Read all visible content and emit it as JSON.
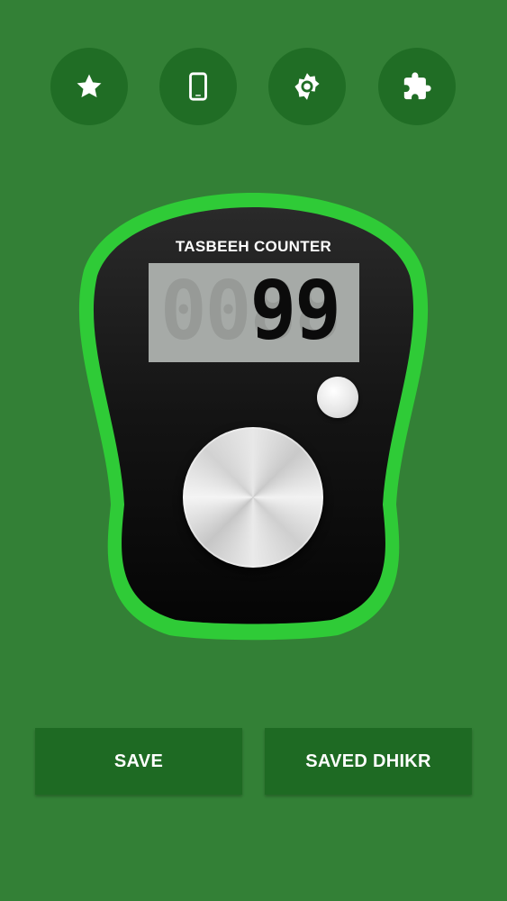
{
  "toolbar": {
    "icons": [
      "star-icon",
      "smartphone-icon",
      "brightness-icon",
      "puzzle-icon"
    ]
  },
  "counter": {
    "title": "TASBEEH COUNTER",
    "count": "99",
    "ghost_digits": "0088"
  },
  "actions": {
    "save_label": "SAVE",
    "saved_label": "SAVED DHIKR"
  },
  "colors": {
    "background": "#338036",
    "button_dark": "#206d25",
    "counter_outline": "#2fcb37",
    "lcd": "#a6aaa7"
  }
}
